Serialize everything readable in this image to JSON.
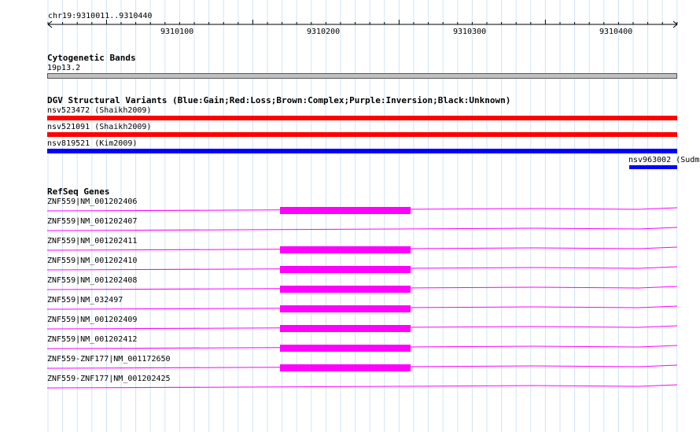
{
  "ruler": {
    "position_label": "chr19:9310011..9310440",
    "ticks": [
      "9310100",
      "9310200",
      "9310300",
      "9310400"
    ]
  },
  "cytoband_track": {
    "title": "Cytogenetic Bands",
    "band_label": "19p13.2",
    "band_color": "#c0c0c0"
  },
  "dgv_track": {
    "title": "DGV Structural Variants (Blue:Gain;Red:Loss;Brown:Complex;Purple:Inversion;Black:Unknown)",
    "features": [
      {
        "label": "nsv523472 (Shaikh2009)",
        "color": "#ff0000"
      },
      {
        "label": "nsv521091 (Shaikh2009)",
        "color": "#ff0000"
      },
      {
        "label": "nsv819521 (Kim2009)",
        "color": "#0000ff"
      },
      {
        "label": "nsv963002 (Sudm",
        "color": "#0000ff"
      }
    ]
  },
  "refseq_track": {
    "title": "RefSeq Genes",
    "color": "#ff00ff",
    "genes": [
      {
        "label": "ZNF559|NM_001202406"
      },
      {
        "label": "ZNF559|NM_001202407"
      },
      {
        "label": "ZNF559|NM_001202411"
      },
      {
        "label": "ZNF559|NM_001202410"
      },
      {
        "label": "ZNF559|NM_001202408"
      },
      {
        "label": "ZNF559|NM_032497"
      },
      {
        "label": "ZNF559|NM_001202409"
      },
      {
        "label": "ZNF559|NM_001202412"
      },
      {
        "label": "ZNF559-ZNF177|NM_001172650"
      },
      {
        "label": "ZNF559-ZNF177|NM_001202425"
      }
    ]
  }
}
